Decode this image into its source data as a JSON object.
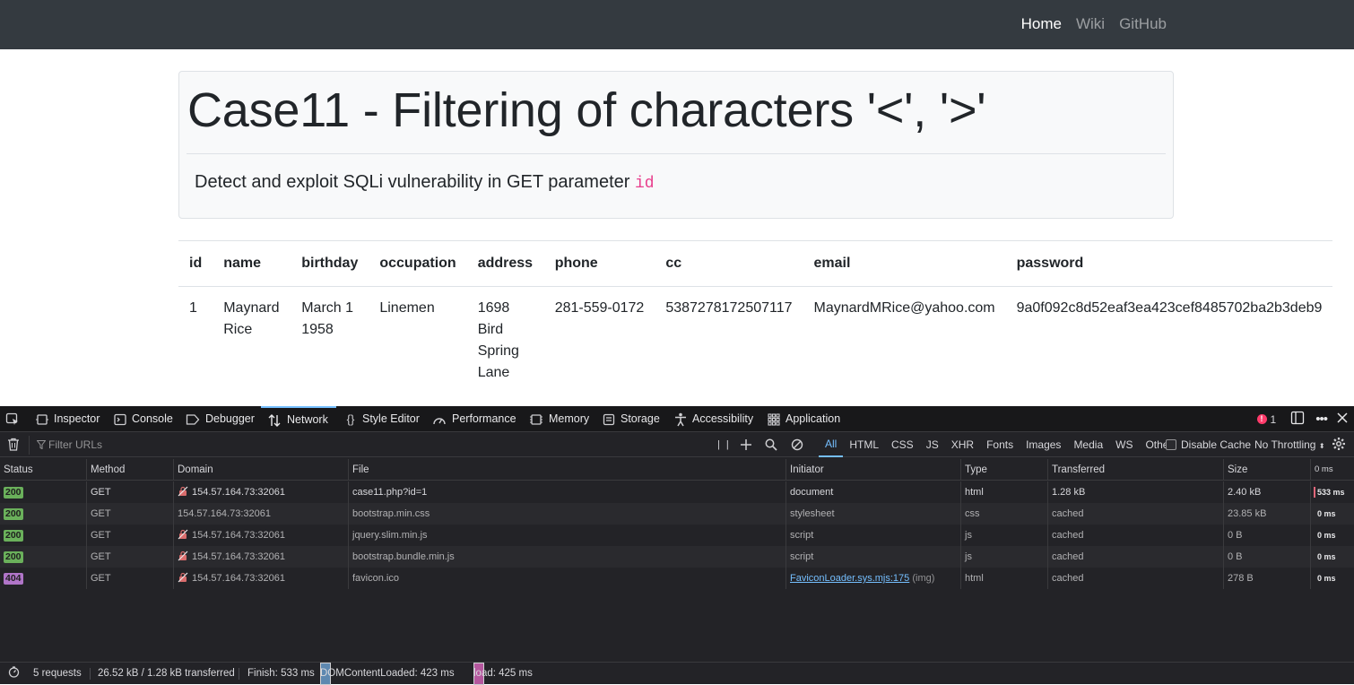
{
  "navbar": {
    "links": [
      "Home",
      "Wiki",
      "GitHub"
    ],
    "active": "Home"
  },
  "jumbotron": {
    "title": "Case11 - Filtering of characters '<', '>'",
    "lead": "Detect and exploit SQLi vulnerability in GET parameter",
    "param": "id"
  },
  "table": {
    "headers": [
      "id",
      "name",
      "birthday",
      "occupation",
      "address",
      "phone",
      "cc",
      "email",
      "password"
    ],
    "rows": [
      [
        "1",
        "Maynard Rice",
        "March 1 1958",
        "Linemen",
        "1698 Bird Spring Lane",
        "281-559-0172",
        "5387278172507117",
        "MaynardMRice@yahoo.com",
        "9a0f092c8d52eaf3ea423cef8485702ba2b3deb9"
      ]
    ]
  },
  "devtools": {
    "tabs": [
      "Inspector",
      "Console",
      "Debugger",
      "Network",
      "Style Editor",
      "Performance",
      "Memory",
      "Storage",
      "Accessibility",
      "Application"
    ],
    "active_tab": "Network",
    "error_count": "1",
    "filter_placeholder": "Filter URLs",
    "type_filters": [
      "All",
      "HTML",
      "CSS",
      "JS",
      "XHR",
      "Fonts",
      "Images",
      "Media",
      "WS",
      "Other"
    ],
    "active_type": "All",
    "disable_cache_label": "Disable Cache",
    "throttling": "No Throttling",
    "columns": [
      "Status",
      "Method",
      "Domain",
      "File",
      "Initiator",
      "Type",
      "Transferred",
      "Size",
      "0 ms"
    ],
    "requests": [
      {
        "status": "200",
        "method": "GET",
        "domain": "154.57.164.73:32061",
        "file": "case11.php?id=1",
        "initiator": "document",
        "initiator_extra": "",
        "type": "html",
        "transferred": "1.28 kB",
        "size": "2.40 kB",
        "timing": "533 ms",
        "insecure": true
      },
      {
        "status": "200",
        "method": "GET",
        "domain": "154.57.164.73:32061",
        "file": "bootstrap.min.css",
        "initiator": "stylesheet",
        "initiator_extra": "",
        "type": "css",
        "transferred": "cached",
        "size": "23.85 kB",
        "timing": "0 ms",
        "insecure": false
      },
      {
        "status": "200",
        "method": "GET",
        "domain": "154.57.164.73:32061",
        "file": "jquery.slim.min.js",
        "initiator": "script",
        "initiator_extra": "",
        "type": "js",
        "transferred": "cached",
        "size": "0 B",
        "timing": "0 ms",
        "insecure": true
      },
      {
        "status": "200",
        "method": "GET",
        "domain": "154.57.164.73:32061",
        "file": "bootstrap.bundle.min.js",
        "initiator": "script",
        "initiator_extra": "",
        "type": "js",
        "transferred": "cached",
        "size": "0 B",
        "timing": "0 ms",
        "insecure": true
      },
      {
        "status": "404",
        "method": "GET",
        "domain": "154.57.164.73:32061",
        "file": "favicon.ico",
        "initiator": "FaviconLoader.sys.mjs:175",
        "initiator_extra": "(img)",
        "type": "html",
        "transferred": "cached",
        "size": "278 B",
        "timing": "0 ms",
        "insecure": true
      }
    ],
    "summary": {
      "requests": "5 requests",
      "transferred": "26.52 kB / 1.28 kB transferred",
      "finish": "Finish: 533 ms",
      "dom_content_loaded": "DOMContentLoaded: 423 ms",
      "load": "load: 425 ms"
    },
    "colors": {
      "accent": "#75bfff",
      "status_ok": "#6ab05b",
      "status_not_found": "#b075c8",
      "dcl": "#5e88b0",
      "load": "#b5579e"
    }
  }
}
